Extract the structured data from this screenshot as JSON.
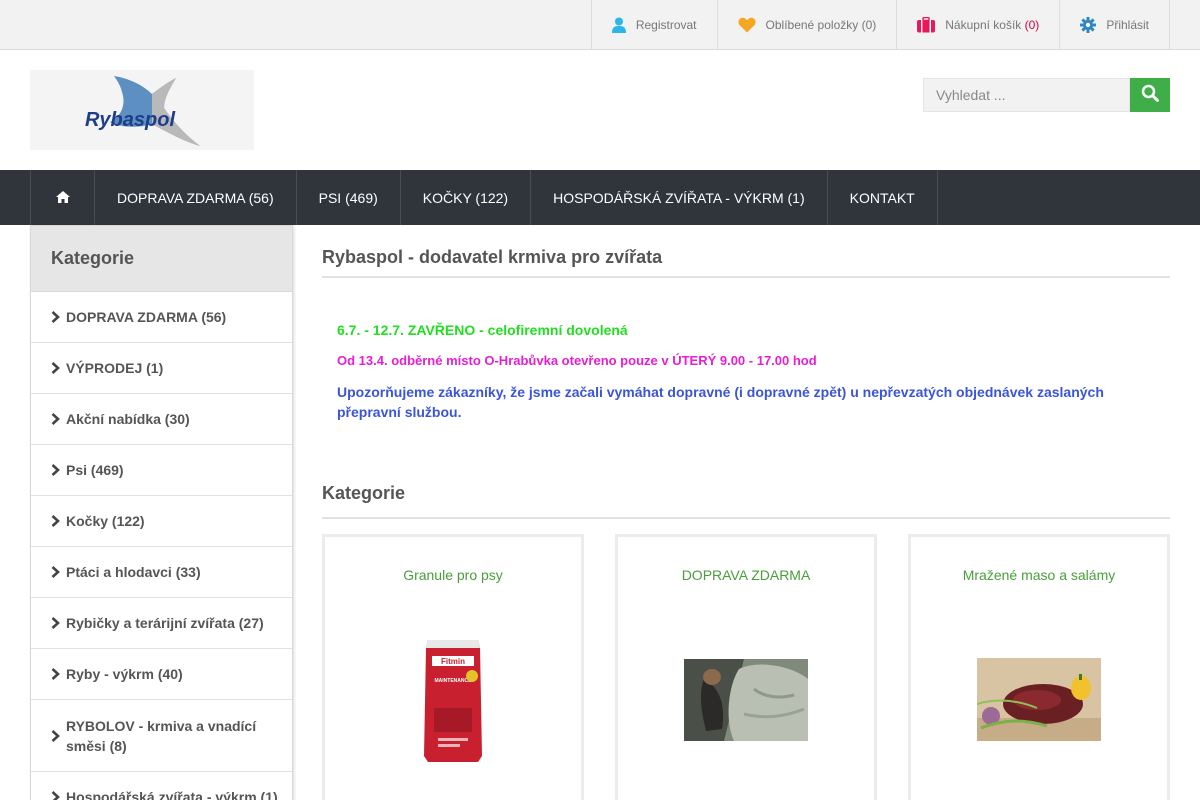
{
  "topbar": {
    "register": "Registrovat",
    "favorites": "Oblíbené položky (0)",
    "cart_label": "Nákupní košík",
    "cart_count": "(0)",
    "login": "Přihlásit"
  },
  "logo": {
    "text": "Rybaspol"
  },
  "search": {
    "placeholder": "Vyhledat ..."
  },
  "nav": {
    "items": [
      "DOPRAVA ZDARMA (56)",
      "PSI (469)",
      "KOČKY (122)",
      "HOSPODÁŘSKÁ ZVÍŘATA - VÝKRM (1)",
      "KONTAKT"
    ]
  },
  "sidebar": {
    "title": "Kategorie",
    "items": [
      "DOPRAVA ZDARMA (56)",
      "VÝPRODEJ (1)",
      "Akční nabídka (30)",
      "Psi (469)",
      "Kočky (122)",
      "Ptáci a hlodavci (33)",
      "Rybičky a terárijní zvířata (27)",
      "Ryby - výkrm (40)",
      "RYBOLOV - krmiva a vnadící směsi (8)",
      "Hospodářská zvířata - výkrm (1)"
    ]
  },
  "main": {
    "title": "Rybaspol - dodavatel krmiva pro zvířata",
    "notice_1": "6.7. - 12.7. ZAVŘENO - celofiremní dovolená",
    "notice_2": "Od 13.4. odběrné místo O-Hrabůvka otevřeno pouze v ÚTERÝ 9.00 - 17.00 hod",
    "notice_3": "Upozorňujeme zákazníky, že jsme začali vymáhat dopravné (i dopravné zpět) u nepřevzatých objednávek zaslaných přepravní službou.",
    "section_title": "Kategorie",
    "cards": [
      {
        "title": "Granule pro psy",
        "image_text": "Fitmin",
        "image_subtext": "MAINTENANCE"
      },
      {
        "title": "DOPRAVA ZDARMA"
      },
      {
        "title": "Mražené maso a salámy"
      }
    ]
  },
  "colors": {
    "accent_green": "#3fae49",
    "nav_bg": "#2f353b",
    "notice_green": "#22dd22",
    "notice_magenta": "#e61fd2",
    "notice_blue": "#3b55d8",
    "cart_count_red": "#d6003d"
  }
}
